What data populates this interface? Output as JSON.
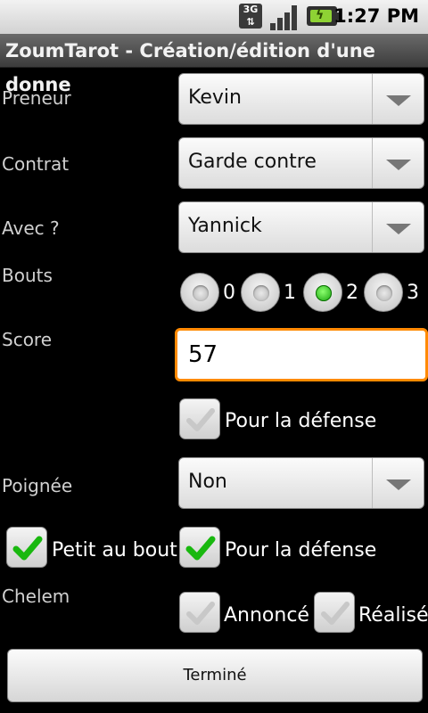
{
  "status": {
    "network": "3G",
    "time": "1:27 PM"
  },
  "app": {
    "title": "ZoumTarot - Création/édition d'une donne"
  },
  "form": {
    "preneur": {
      "label": "Preneur",
      "value": "Kevin"
    },
    "contrat": {
      "label": "Contrat",
      "value": "Garde contre"
    },
    "avec": {
      "label": "Avec ?",
      "value": "Yannick"
    },
    "bouts": {
      "label": "Bouts",
      "options": [
        "0",
        "1",
        "2",
        "3"
      ],
      "selected": "2"
    },
    "score": {
      "label": "Score",
      "value": "57"
    },
    "score_defense": {
      "label": "Pour la défense",
      "checked": false
    },
    "poignee": {
      "label": "Poignée",
      "value": "Non"
    },
    "petit_au_bout": {
      "label": "Petit au bout",
      "checked": true
    },
    "petit_defense": {
      "label": "Pour la défense",
      "checked": true
    },
    "chelem": {
      "label": "Chelem"
    },
    "chelem_annonce": {
      "label": "Annoncé",
      "checked": false
    },
    "chelem_realise": {
      "label": "Réalisé",
      "checked": false
    },
    "done_label": "Terminé"
  }
}
